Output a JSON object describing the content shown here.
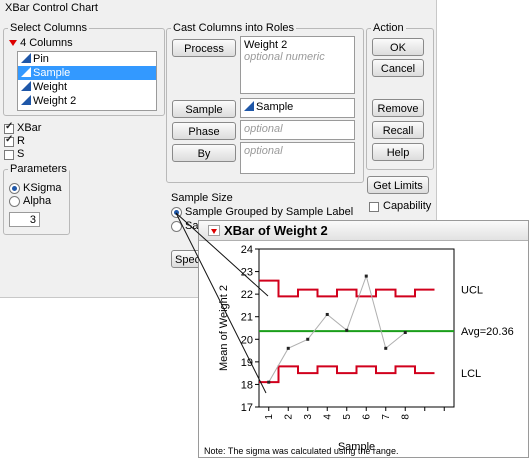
{
  "dialog": {
    "title": "XBar Control Chart",
    "select_columns": {
      "legend": "Select Columns",
      "count_label": "4 Columns",
      "columns": [
        "Pin",
        "Sample",
        "Weight",
        "Weight 2"
      ],
      "selected": "Sample"
    },
    "chart_types": [
      {
        "label": "XBar",
        "checked": true
      },
      {
        "label": "R",
        "checked": true
      },
      {
        "label": "S",
        "checked": false
      }
    ],
    "parameters": {
      "legend": "Parameters",
      "options": [
        {
          "label": "KSigma",
          "selected": true
        },
        {
          "label": "Alpha",
          "selected": false
        }
      ],
      "value": "3"
    },
    "roles": {
      "legend": "Cast Columns into Roles",
      "process_button": "Process",
      "process_value": "Weight 2",
      "process_hint": "optional numeric",
      "sample_label_button": "Sample Label",
      "sample_label_value": "Sample",
      "phase_button": "Phase",
      "phase_hint": "optional",
      "by_button": "By",
      "by_hint": "optional"
    },
    "action": {
      "legend": "Action",
      "buttons": [
        "OK",
        "Cancel",
        "Remove",
        "Recall",
        "Help"
      ],
      "get_limits": "Get Limits",
      "capability_label": "Capability",
      "capability_checked": false
    },
    "sample_size": {
      "label": "Sample Size",
      "options": [
        {
          "label": "Sample Grouped by Sample Label",
          "selected": true
        },
        {
          "label": "Sa",
          "selected": false
        }
      ],
      "spec_button_partial": "Spec"
    }
  },
  "report": {
    "title": "XBar of Weight 2",
    "note": "Note: The sigma was calculated using the range."
  },
  "chart_data": {
    "type": "line",
    "title": "XBar of Weight 2",
    "xlabel": "Sample",
    "ylabel": "Mean of Weight 2",
    "x": [
      1,
      2,
      3,
      4,
      5,
      6,
      7,
      8
    ],
    "xticks": [
      "1",
      "2",
      "3",
      "4",
      "5",
      "6",
      "7",
      "8"
    ],
    "ylim": [
      17,
      24
    ],
    "yticks": [
      17,
      18,
      19,
      20,
      21,
      22,
      23,
      24
    ],
    "series": [
      {
        "values": [
          18.1,
          19.6,
          20.0,
          21.1,
          20.4,
          22.8,
          19.6,
          20.3
        ]
      }
    ],
    "center": {
      "value": 20.36,
      "label": "Avg=20.36",
      "color": "#1a9e1a"
    },
    "ucl": {
      "label": "UCL",
      "values": [
        22.6,
        21.9,
        22.2,
        21.9,
        22.2,
        21.9,
        22.2,
        21.9,
        22.2
      ],
      "color": "#d1001c"
    },
    "lcl": {
      "label": "LCL",
      "values": [
        18.1,
        18.8,
        18.5,
        18.8,
        18.5,
        18.8,
        18.5,
        18.8,
        18.5
      ],
      "color": "#d1001c"
    },
    "point_color": "#222222",
    "line_color": "#b0b0b0"
  }
}
